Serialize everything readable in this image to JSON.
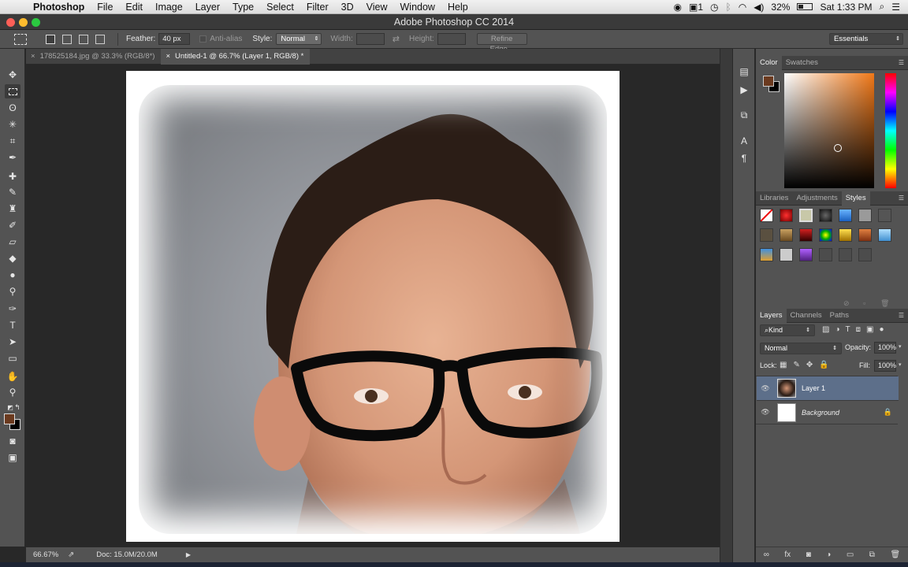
{
  "menubar": {
    "apple_glyph": "",
    "items": [
      "Photoshop",
      "File",
      "Edit",
      "Image",
      "Layer",
      "Type",
      "Select",
      "Filter",
      "3D",
      "View",
      "Window",
      "Help"
    ],
    "status": {
      "adobe_badge": "1",
      "battery": "32%",
      "clock": "Sat 1:33 PM"
    }
  },
  "window": {
    "title": "Adobe Photoshop CC 2014"
  },
  "options": {
    "feather_label": "Feather:",
    "feather_value": "40 px",
    "antialias_label": "Anti-alias",
    "style_label": "Style:",
    "style_value": "Normal",
    "width_label": "Width:",
    "height_label": "Height:",
    "refine_edge": "Refine Edge...",
    "workspace": "Essentials"
  },
  "doc_tabs": [
    {
      "label": "178525184.jpg @ 33.3% (RGB/8*)",
      "close": "×"
    },
    {
      "label": "Untitled-1 @ 66.7% (Layer 1, RGB/8) *",
      "close": "×"
    }
  ],
  "status_bar": {
    "zoom": "66.67%",
    "doc": "Doc: 15.0M/20.0M"
  },
  "color_panel": {
    "tabs": [
      "Color",
      "Swatches"
    ],
    "foreground": "#6b3a1f",
    "background": "#000000",
    "hue": "#f07818"
  },
  "styles_panel": {
    "tabs": [
      "Libraries",
      "Adjustments",
      "Styles"
    ]
  },
  "layers_panel": {
    "tabs": [
      "Layers",
      "Channels",
      "Paths"
    ],
    "kind_label": "Kind",
    "blend_mode": "Normal",
    "opacity_label": "Opacity:",
    "opacity_value": "100%",
    "lock_label": "Lock:",
    "fill_label": "Fill:",
    "fill_value": "100%",
    "layers": [
      {
        "name": "Layer 1",
        "selected": true
      },
      {
        "name": "Background",
        "selected": false,
        "locked": true
      }
    ]
  },
  "colors": {
    "accent_selected_layer": "#5d6f8a",
    "panel_bg": "#535353"
  }
}
